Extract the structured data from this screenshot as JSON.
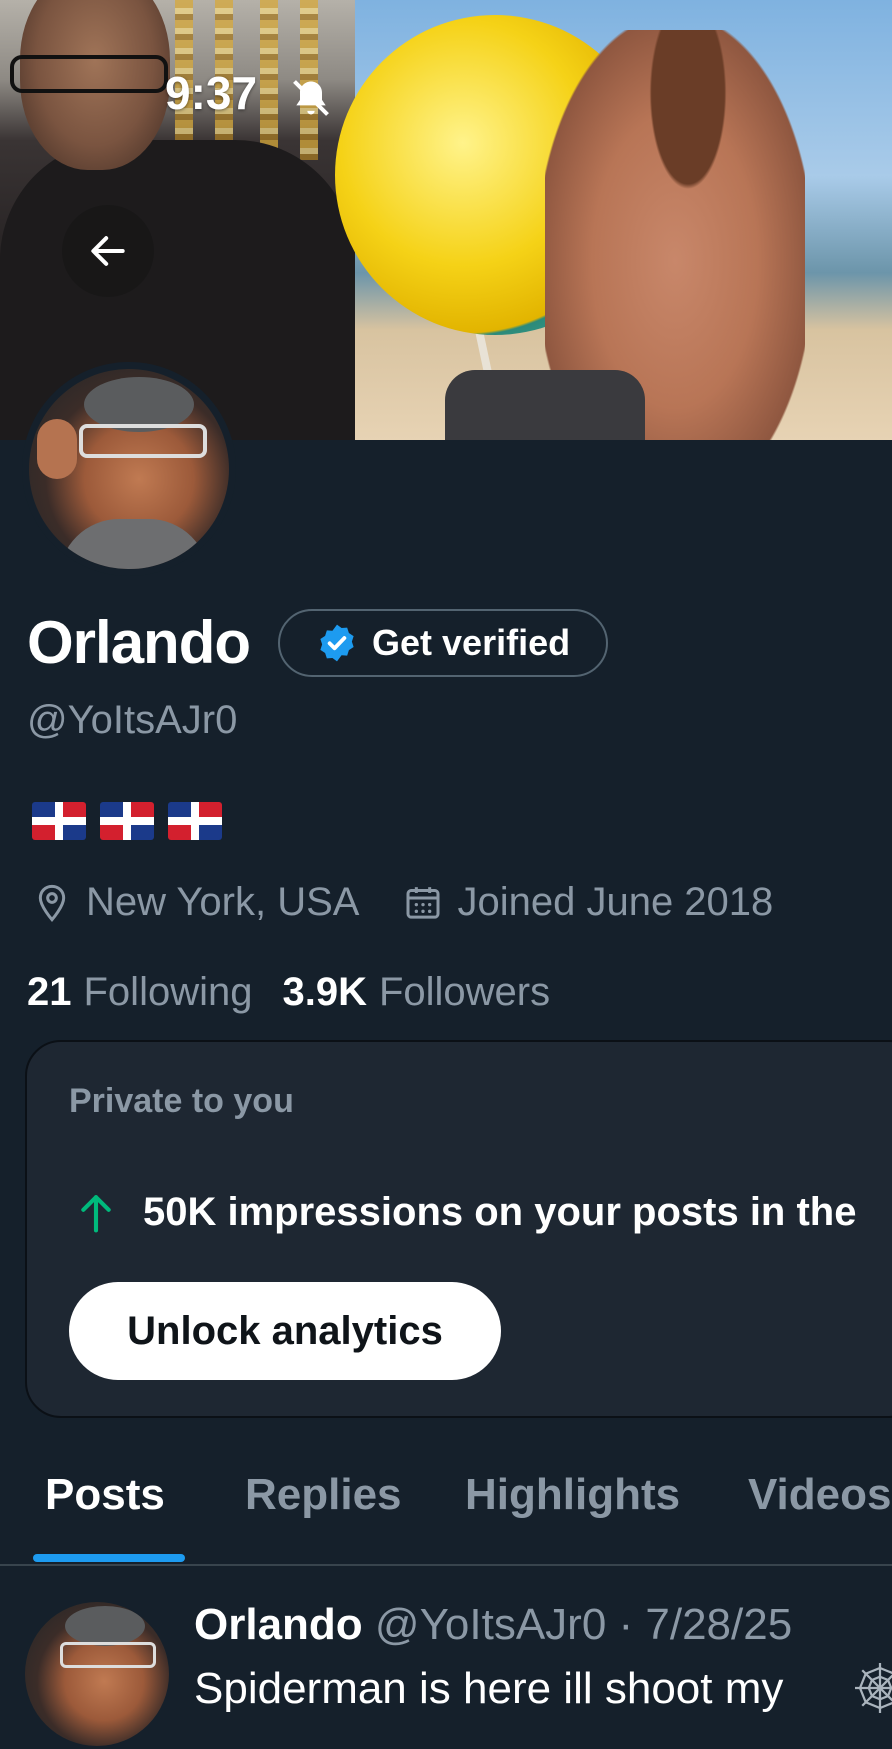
{
  "status_bar": {
    "time": "9:37"
  },
  "profile": {
    "display_name": "Orlando",
    "get_verified_label": "Get verified",
    "handle": "@YoItsAJr0",
    "bio_emojis": [
      "flag-dominican-republic",
      "flag-dominican-republic",
      "flag-dominican-republic"
    ],
    "location": "New York, USA",
    "joined": "Joined June 2018",
    "following_count": "21",
    "following_label": "Following",
    "followers_count": "3.9K",
    "followers_label": "Followers"
  },
  "private_card": {
    "label": "Private to you",
    "impressions_text": "50K impressions on your posts in the",
    "unlock_label": "Unlock analytics"
  },
  "tabs": [
    {
      "label": "Posts",
      "active": true
    },
    {
      "label": "Replies",
      "active": false
    },
    {
      "label": "Highlights",
      "active": false
    },
    {
      "label": "Videos",
      "active": false
    }
  ],
  "post": {
    "author": "Orlando",
    "handle_date": "@YoItsAJr0 · 7/28/25",
    "text": "Spiderman is here ill shoot my"
  },
  "colors": {
    "background": "#15202b",
    "accent": "#1d9bf0",
    "muted_text": "#8b98a5",
    "up_arrow": "#00ba7c"
  }
}
